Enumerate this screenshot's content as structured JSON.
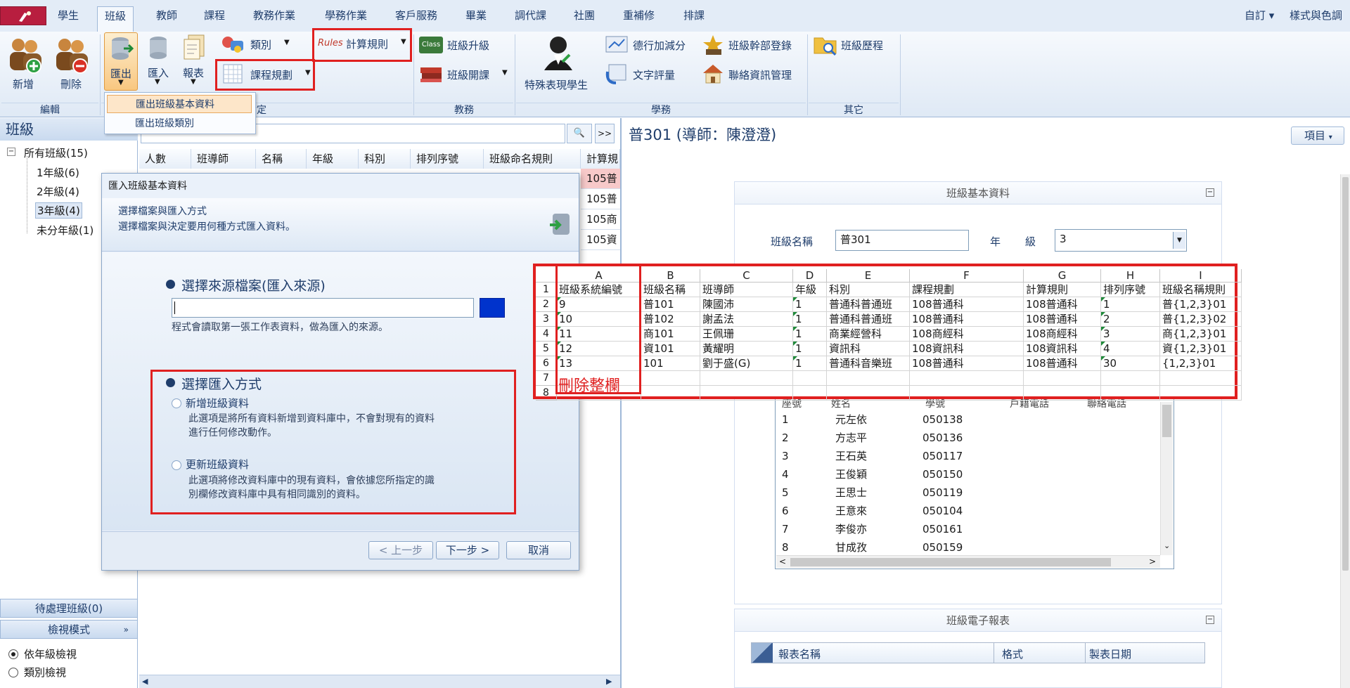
{
  "menu": {
    "tabs": [
      "學生",
      "班級",
      "教師",
      "課程",
      "教務作業",
      "學務作業",
      "客戶服務",
      "畢業",
      "調代課",
      "社團",
      "重補修",
      "排課"
    ],
    "active": "班級",
    "right_custom": "自訂",
    "right_theme": "樣式與色調"
  },
  "ribbon": {
    "add": "新增",
    "delete": "刪除",
    "export": "匯出",
    "import": "匯入",
    "report": "報表",
    "category": "類別",
    "course_plan": "課程規劃",
    "calc_rules": "計算規則",
    "rules_badge": "Rules",
    "class_promote": "班級升級",
    "class_open": "班級開課",
    "class_badge": "Class",
    "special_students": "特殊表現學生",
    "merit_adjust": "德行加減分",
    "text_eval": "文字評量",
    "cadre_register": "班級幹部登錄",
    "contact_mgmt": "聯絡資訊管理",
    "class_history": "班級歷程",
    "groups": {
      "edit": "編輯",
      "assign": "指定",
      "academic": "教務",
      "student_affairs": "學務",
      "others": "其它"
    }
  },
  "export_menu": [
    "匯出班級基本資料",
    "匯出班級類別"
  ],
  "left": {
    "title": "班級",
    "tree": [
      "所有班級(15)",
      "1年級(6)",
      "2年級(4)",
      "3年級(4)",
      "未分年級(1)"
    ],
    "pending": "待處理班級(0)",
    "view_mode": "檢視模式",
    "radio_grade": "依年級檢視",
    "radio_category": "類別檢視"
  },
  "list": {
    "search_btn": "🔍",
    "expand_btn": ">>",
    "headers": [
      "人數",
      "班導師",
      "名稱",
      "年級",
      "科別",
      "排列序號",
      "班級命名規則",
      "計算規"
    ],
    "rows": [
      "105普",
      "105普",
      "105商",
      "105資"
    ]
  },
  "right": {
    "title": "普301 (導師：陳澄澄)",
    "items_btn": "項目",
    "basic_card": "班級基本資料",
    "class_name_label": "班級名稱",
    "class_name_value": "普301",
    "grade_label_1": "年",
    "grade_label_2": "級",
    "grade_value": "3",
    "students_header": [
      "座號",
      "姓名",
      "學號",
      "戶籍電話",
      "聯絡電話"
    ],
    "students": [
      [
        "1",
        "元左依",
        "050138"
      ],
      [
        "2",
        "方志平",
        "050136"
      ],
      [
        "3",
        "王石英",
        "050117"
      ],
      [
        "4",
        "王俊穎",
        "050150"
      ],
      [
        "5",
        "王思士",
        "050119"
      ],
      [
        "6",
        "王意來",
        "050104"
      ],
      [
        "7",
        "李俊亦",
        "050161"
      ],
      [
        "8",
        "甘成孜",
        "050159"
      ]
    ],
    "report_card": "班級電子報表",
    "report_headers": [
      "報表名稱",
      "格式",
      "製表日期"
    ]
  },
  "dialog": {
    "title": "匯入班級基本資料",
    "hdr_title": "選擇檔案與匯入方式",
    "hdr_desc": "選擇檔案與決定要用何種方式匯入資料。",
    "source_title": "選擇來源檔案(匯入來源)",
    "source_note": "程式會讀取第一張工作表資料，做為匯入的來源。",
    "method_title": "選擇匯入方式",
    "opt_add": "新增班級資料",
    "opt_add_desc1": "此選項是將所有資料新增到資料庫中，不會對現有的資料",
    "opt_add_desc2": "進行任何修改動作。",
    "opt_update": "更新班級資料",
    "opt_update_desc1": "此選項將修改資料庫中的現有資料，會依據您所指定的識",
    "opt_update_desc2": "別欄修改資料庫中具有相同識別的資料。",
    "btn_prev": "< 上一步",
    "btn_next": "下一步 >",
    "btn_cancel": "取消"
  },
  "sheet": {
    "cols": [
      "A",
      "B",
      "C",
      "D",
      "E",
      "F",
      "G",
      "H",
      "I"
    ],
    "row_nums": [
      "1",
      "2",
      "3",
      "4",
      "5",
      "6",
      "7",
      "8"
    ],
    "rows": [
      [
        "班級系統編號",
        "班級名稱",
        "班導師",
        "年級",
        "科別",
        "課程規劃",
        "計算規則",
        "排列序號",
        "班級名稱規則"
      ],
      [
        "9",
        "普101",
        "陳國沛",
        "1",
        "普通科普通班",
        "108普通科",
        "108普通科",
        "1",
        "普{1,2,3}01"
      ],
      [
        "10",
        "普102",
        "謝孟法",
        "1",
        "普通科普通班",
        "108普通科",
        "108普通科",
        "2",
        "普{1,2,3}02"
      ],
      [
        "11",
        "商101",
        "王佩珊",
        "1",
        "商業經營科",
        "108商經科",
        "108商經科",
        "3",
        "商{1,2,3}01"
      ],
      [
        "12",
        "資101",
        "黃耀明",
        "1",
        "資訊科",
        "108資訊科",
        "108資訊科",
        "4",
        "資{1,2,3}01"
      ],
      [
        "13",
        "101",
        "劉于盛(G)",
        "1",
        "普通科音樂班",
        "108普通科",
        "108普通科",
        "30",
        "{1,2,3}01"
      ]
    ],
    "annotation": "刪除整欄"
  },
  "colors": {
    "highlight_red": "#e02020",
    "ribbon_text": "#1f3d6b",
    "sheet_marker": "#1f8a3a"
  }
}
